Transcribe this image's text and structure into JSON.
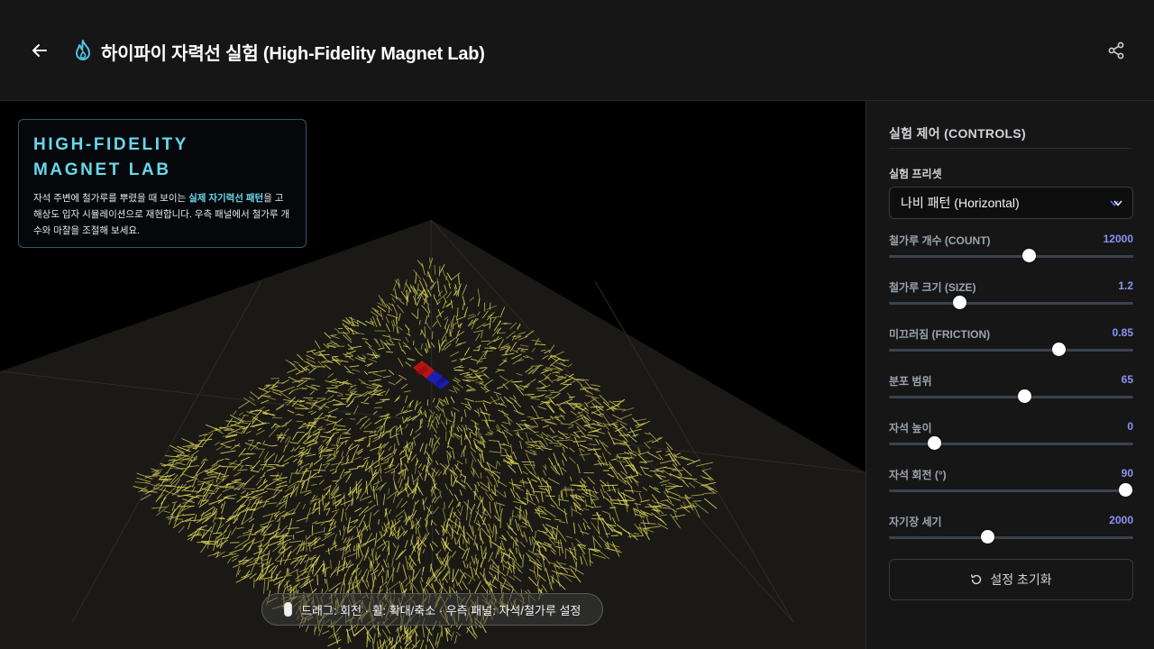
{
  "header": {
    "title": "하이파이 자력선 실험 (High-Fidelity Magnet Lab)",
    "back_icon": "arrow-left-icon",
    "title_icon": "flame-icon",
    "share_icon": "share-icon",
    "accent_color": "#4fc3e8"
  },
  "info_card": {
    "title": "HIGH-FIDELITY MAGNET LAB",
    "desc_pre": "자석 주변에 철가루를 뿌렸을 때 보이는 ",
    "desc_highlight": "실제 자기력선 패턴",
    "desc_post": "을 고해상도 입자 시뮬레이션으로 재현합니다. 우측 패널에서 철가루 개수와 마찰을 조절해 보세요."
  },
  "hint": {
    "icon": "mouse-icon",
    "text": "드래그: 회전 · 휠: 확대/축소 · 우측 패널: 자석/철가루 설정"
  },
  "controls": {
    "title": "실험 제어 (CONTROLS)",
    "preset_label": "실험 프리셋",
    "preset_value": "나비 패턴 (Horizontal)",
    "sliders": [
      {
        "label": "철가루 개수 (COUNT)",
        "value": "12000",
        "fraction": 0.575
      },
      {
        "label": "철가루 크기 (SIZE)",
        "value": "1.2",
        "fraction": 0.289
      },
      {
        "label": "미끄러짐 (FRICTION)",
        "value": "0.85",
        "fraction": 0.697
      },
      {
        "label": "분포 범위",
        "value": "65",
        "fraction": 0.556
      },
      {
        "label": "자석 높이",
        "value": "0",
        "fraction": 0.186
      },
      {
        "label": "자석 회전 (°)",
        "value": "90",
        "fraction": 0.967
      },
      {
        "label": "자기장 세기",
        "value": "2000",
        "fraction": 0.405
      }
    ],
    "reset_label": "설정 초기화",
    "reset_icon": "rotate-ccw-icon",
    "slider_value_color": "#8b93f5"
  }
}
